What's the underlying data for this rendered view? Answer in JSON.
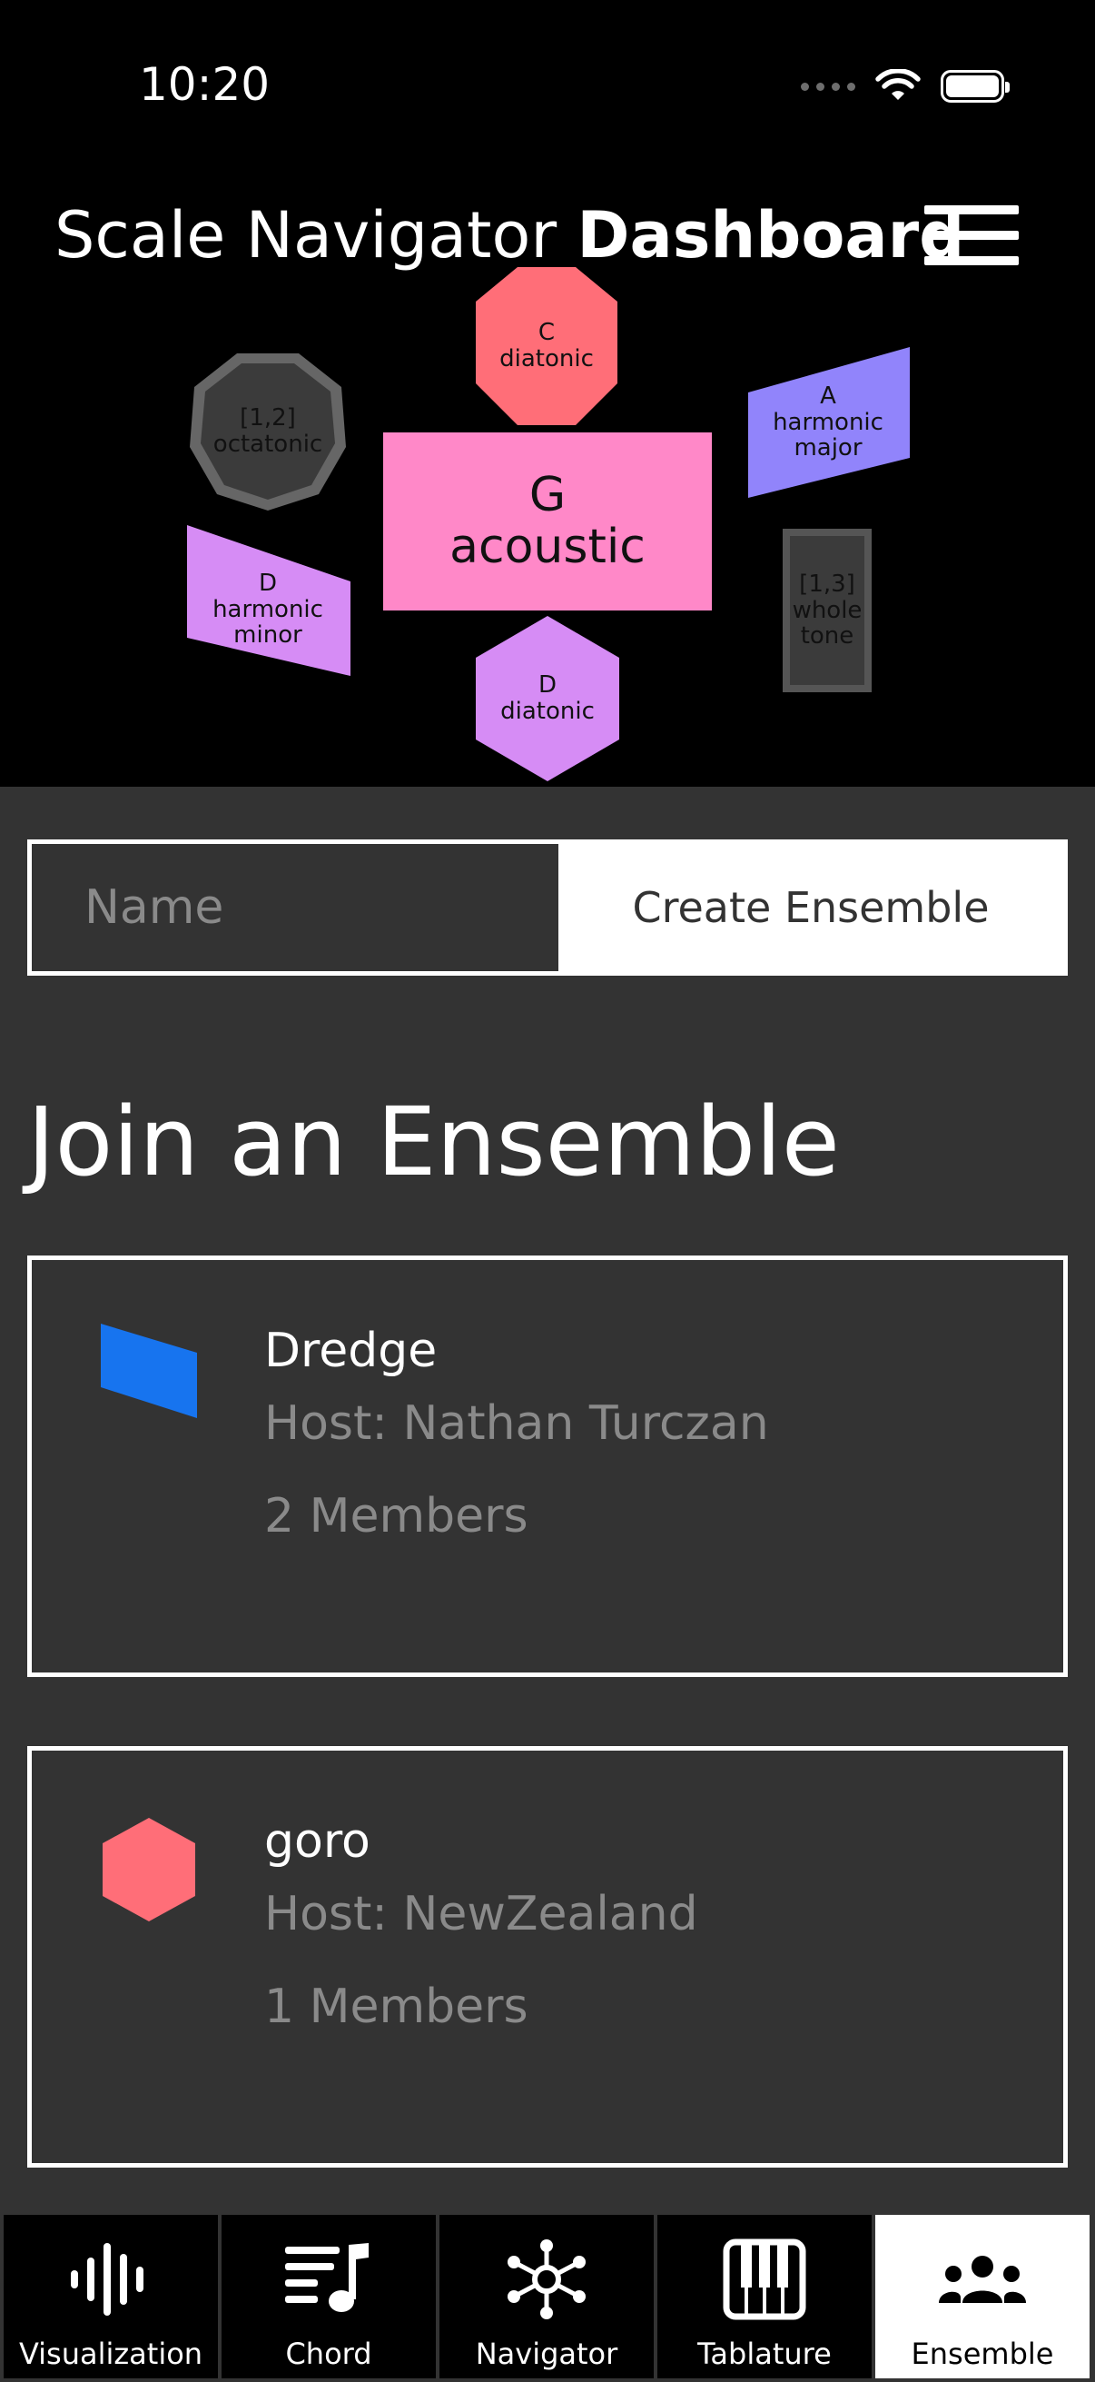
{
  "status_bar": {
    "time": "10:20"
  },
  "header": {
    "title_regular": "Scale Navigator",
    "title_bold": "Dashboard"
  },
  "scales": {
    "center": "G\nacoustic",
    "top": "C\ndiatonic",
    "bottom": "D\ndiatonic",
    "octatonic": "[1,2]\noctatonic",
    "harmonic_major": "A\nharmonic\nmajor",
    "harmonic_minor": "D\nharmonic\nminor",
    "whole_tone": "[1,3]\nwhole\ntone"
  },
  "colors": {
    "acoustic": "#ff88c8",
    "diatonic_c": "#ff6e78",
    "diatonic_d": "#d68cf5",
    "harmonic_major": "#9184fb",
    "harmonic_minor": "#d68cf5",
    "octatonic": "#666666",
    "whole_tone": "#3b3b3b",
    "dredge_icon": "#1774ef",
    "goro_icon": "#ff6e78"
  },
  "create": {
    "placeholder": "Name",
    "button_label": "Create Ensemble"
  },
  "join": {
    "title": "Join an Ensemble"
  },
  "ensembles": [
    {
      "name": "Dredge",
      "host": "Host: Nathan Turczan",
      "members": "2 Members",
      "icon": "parallelogram-icon"
    },
    {
      "name": "goro",
      "host": "Host: NewZealand",
      "members": "1 Members",
      "icon": "hexagon-icon"
    }
  ],
  "tabs": [
    {
      "label": "Visualization",
      "icon": "waveform-icon"
    },
    {
      "label": "Chord",
      "icon": "music-note-list-icon"
    },
    {
      "label": "Navigator",
      "icon": "network-icon"
    },
    {
      "label": "Tablature",
      "icon": "piano-keys-icon"
    },
    {
      "label": "Ensemble",
      "icon": "group-icon",
      "active": true
    }
  ]
}
